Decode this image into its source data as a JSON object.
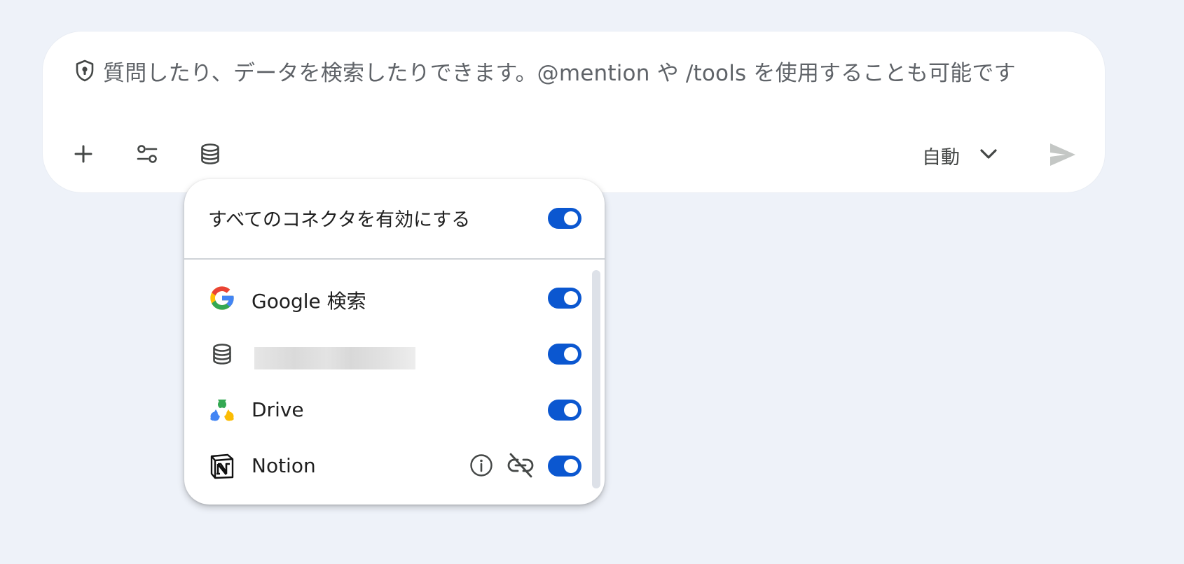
{
  "composer": {
    "placeholder": "質問したり、データを検索したりできます。@mention や /tools を使用することも可能です",
    "model_label": "自動",
    "icons": {
      "shield": "shield-lock-icon",
      "add": "plus-icon",
      "tools": "tune-icon",
      "data": "database-icon",
      "dropdown": "chevron-down-icon",
      "send": "send-icon"
    }
  },
  "connectors_popup": {
    "enable_all_label": "すべてのコネクタを有効にする",
    "enable_all_on": true,
    "items": [
      {
        "name": "Google 検索",
        "icon": "google-g-icon",
        "enabled": true
      },
      {
        "name": "",
        "icon": "database-icon",
        "enabled": true
      },
      {
        "name": "Drive",
        "icon": "drive-icon",
        "enabled": true
      },
      {
        "name": "Notion",
        "icon": "notion-icon",
        "enabled": true
      }
    ],
    "notion_actions": [
      "info-icon",
      "unlink-icon"
    ]
  },
  "colors": {
    "page_bg": "#eef2f9",
    "toggle_on": "#0b57d0",
    "send_disabled": "#c4c7c5",
    "placeholder_text": "#5f6368"
  }
}
